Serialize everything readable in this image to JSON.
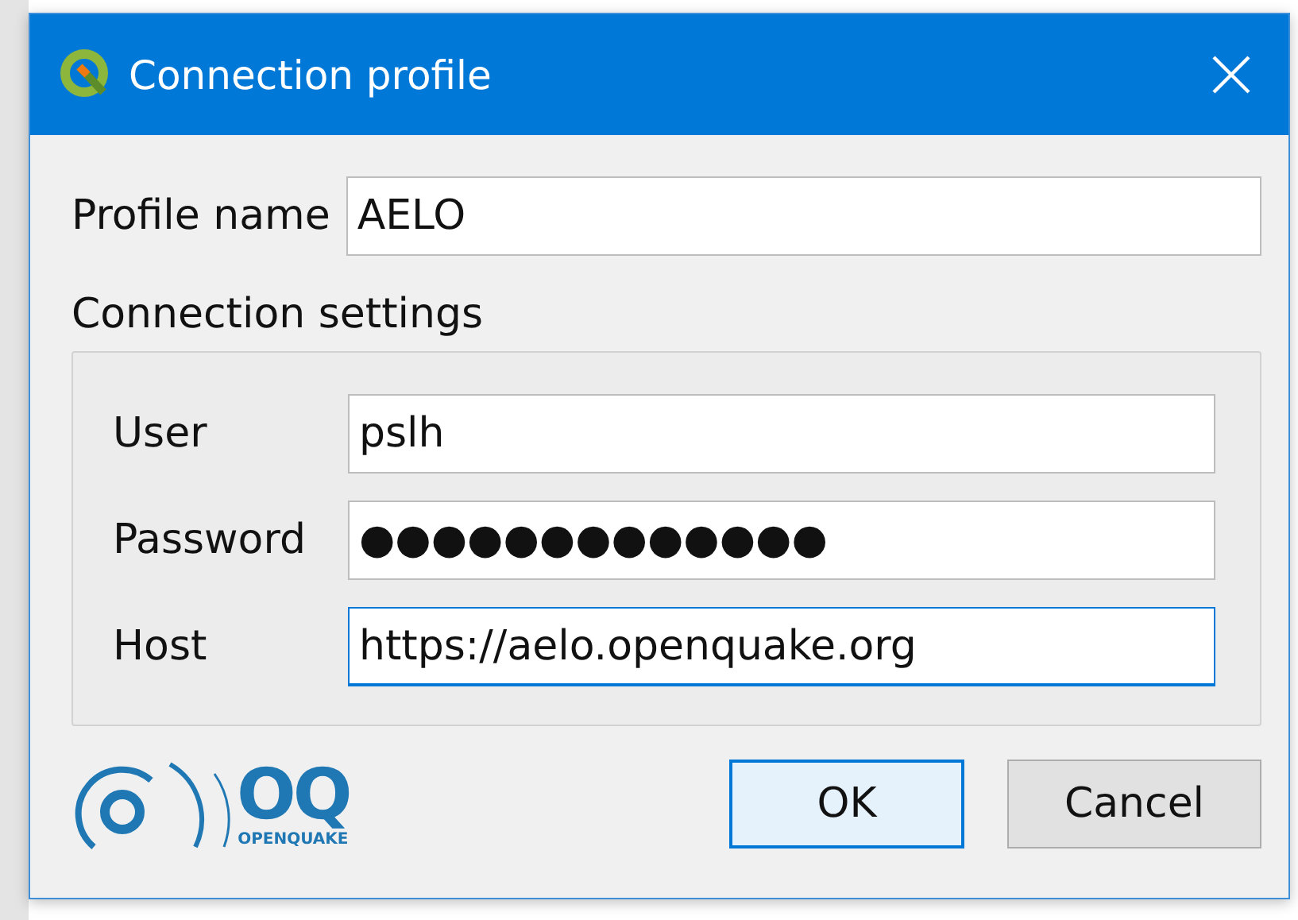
{
  "window": {
    "title": "Connection profile"
  },
  "profile_name": {
    "label": "Profile name",
    "value": "AELO"
  },
  "group": {
    "title": "Connection settings",
    "fields": [
      {
        "label": "User",
        "value": "pslh",
        "focused": false
      },
      {
        "label": "Password",
        "value": "●●●●●●●●●●●●●",
        "focused": false
      },
      {
        "label": "Host",
        "value": "https://aelo.openquake.org",
        "focused": true
      }
    ]
  },
  "logo": {
    "mark": "OQ",
    "name": "OPENQUAKE"
  },
  "buttons": [
    {
      "label": "OK",
      "default": true
    },
    {
      "label": "Cancel",
      "default": false
    }
  ]
}
